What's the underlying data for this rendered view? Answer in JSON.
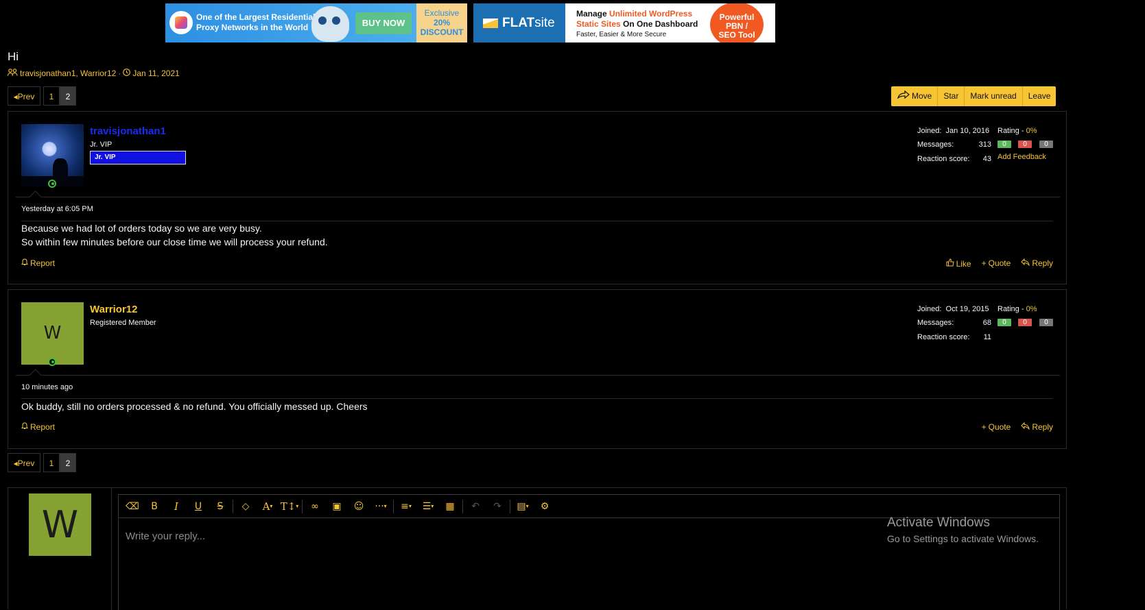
{
  "ads": {
    "proxy": {
      "headline": "One of the Largest Residential Proxy Networks in the World",
      "cta": "BUY NOW",
      "discount": [
        "Exclusive",
        "20%",
        "DISCOUNT"
      ]
    },
    "flatsite": {
      "brand_bold": "FLAT",
      "brand_light": "site",
      "line1_a": "Manage ",
      "line1_b": "Unlimited WordPress",
      "line2_a": "Static Sites",
      "line2_b": " On One Dashboard",
      "line3": "Faster, Easier & More Secure",
      "badge": [
        "Powerful",
        "PBN /",
        "SEO Tool"
      ]
    }
  },
  "thread": {
    "title": "Hi",
    "participants": "travisjonathan1, Warrior12",
    "date": "Jan 11, 2021"
  },
  "pager": {
    "prev": "Prev",
    "pages": [
      "1",
      "2"
    ],
    "current": "2"
  },
  "thread_actions": [
    "Move",
    "Star",
    "Mark unread",
    "Leave"
  ],
  "stat_labels": {
    "joined": "Joined:",
    "messages": "Messages:",
    "reaction": "Reaction score:",
    "rating": "Rating - ",
    "add_feedback": "Add Feedback"
  },
  "posts": [
    {
      "username": "travisjonathan1",
      "username_color": "#1a2cf0",
      "title": "Jr. VIP",
      "banner": "Jr. VIP",
      "joined": "Jan 10, 2016",
      "messages": "313",
      "reaction_score": "43",
      "rating_pct": "0%",
      "rating_counts": [
        "0",
        "0",
        "0"
      ],
      "time": "Yesterday at 6:05 PM",
      "body": [
        "Because we had lot of orders today so we are very busy.",
        "So within few minutes before our close time we will process your refund."
      ],
      "report": "Report",
      "actions": [
        "Like",
        "Quote",
        "Reply"
      ]
    },
    {
      "username": "Warrior12",
      "username_color": "#f7c433",
      "avatar_letter": "W",
      "title": "Registered Member",
      "joined": "Oct 19, 2015",
      "messages": "68",
      "reaction_score": "11",
      "rating_pct": "0%",
      "rating_counts": [
        "0",
        "0",
        "0"
      ],
      "time": "10 minutes ago",
      "body": [
        "Ok buddy, still no orders processed & no refund. You officially messed up. Cheers"
      ],
      "report": "Report",
      "actions": [
        "Quote",
        "Reply"
      ]
    }
  ],
  "editor": {
    "avatar_letter": "W",
    "placeholder": "Write your reply..."
  },
  "watermark": {
    "line1": "Activate Windows",
    "line2": "Go to Settings to activate Windows."
  },
  "colors": {
    "accent": "#f7c433",
    "background": "#000000",
    "positive": "#5cb85c",
    "negative": "#d9534f",
    "neutral": "#777777"
  }
}
